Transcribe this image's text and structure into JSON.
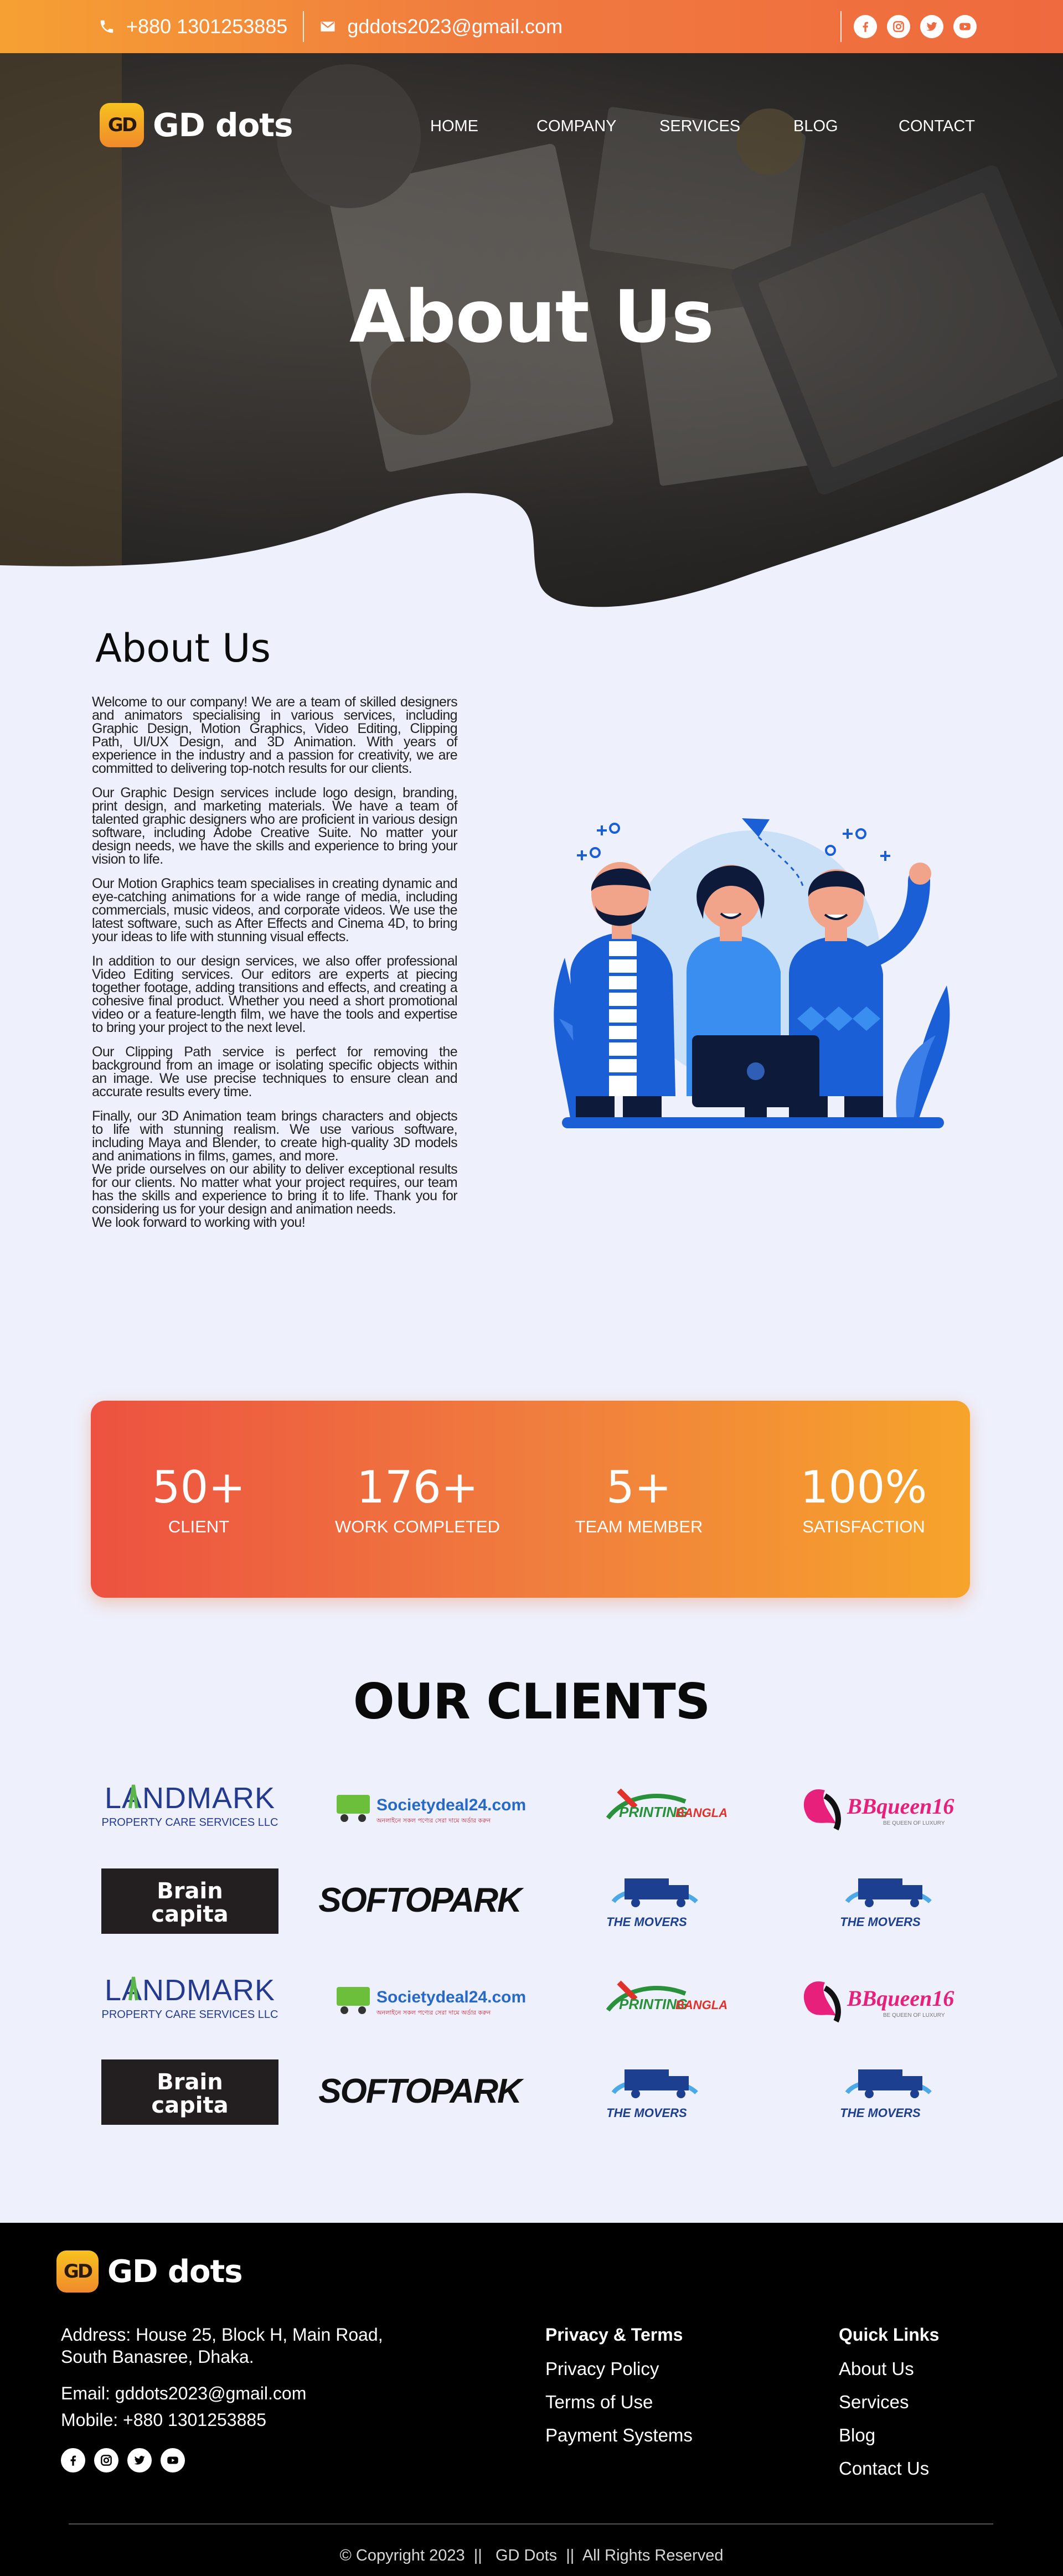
{
  "topbar": {
    "phone": "+880 1301253885",
    "email": "gddots2023@gmail.com",
    "social_icons": [
      "facebook-icon",
      "instagram-icon",
      "twitter-icon",
      "youtube-icon"
    ]
  },
  "brand": {
    "mark": "GD",
    "name": "GD dots"
  },
  "nav": {
    "items": [
      "HOME",
      "COMPANY",
      "SERVICES",
      "BLOG",
      "CONTACT"
    ]
  },
  "hero": {
    "title": "About Us"
  },
  "about": {
    "heading": "About Us",
    "paragraphs": [
      "Welcome to our company! We are a team of skilled designers and animators specialising in various services, including Graphic Design, Motion Graphics, Video Editing, Clipping Path, UI/UX Design, and 3D Animation. With years of experience in the industry and a passion for creativity, we are committed to delivering top-notch results for our clients.",
      "Our Graphic Design services include logo design, branding, print design, and marketing materials. We have a team of talented graphic designers who are proficient in various design software, including Adobe Creative Suite. No matter your design needs, we have the skills and experience to bring your vision to life.",
      "Our Motion Graphics team specialises in creating dynamic and eye-catching animations for a wide range of media, including commercials, music videos, and corporate videos. We use the latest software, such as After Effects and Cinema 4D, to bring your ideas to life with stunning visual effects.",
      "In addition to our design services, we also offer professional Video Editing services. Our editors are experts at piecing together footage, adding transitions and effects, and creating a cohesive final product. Whether you need a short promotional video or a feature-length film, we have the tools and expertise to bring your project to the next level.",
      "Our Clipping Path service is perfect for removing the background from an image or isolating specific objects within an image. We use precise techniques to ensure clean and accurate results every time.",
      "Finally, our 3D Animation team brings characters and objects to life with stunning realism. We use various software, including Maya and Blender, to create high-quality 3D models and animations in films, games, and more.",
      "We pride ourselves on our ability to deliver exceptional results for our clients. No matter what your project requires, our team has the skills and experience to bring it to life. Thank you for considering us for your design and animation needs.",
      "We look forward to working with you!"
    ]
  },
  "stats": [
    {
      "value": "50+",
      "label": "CLIENT"
    },
    {
      "value": "176+",
      "label": "WORK COMPLETED"
    },
    {
      "value": "5+",
      "label": "TEAM MEMBER"
    },
    {
      "value": "100%",
      "label": "SATISFACTION"
    }
  ],
  "clients": {
    "heading": "OUR CLIENTS",
    "logos": {
      "landmark": {
        "title": "LANDMARK",
        "sub": "PROPERTY CARE SERVICES LLC"
      },
      "societydeal": {
        "title": "Societydeal24.com",
        "sub": "অনলাইনে সকল পণ্যের সেরা দামে অর্ডার করুন"
      },
      "printing": {
        "title": "PRINTING",
        "accent": "BANGLA"
      },
      "bbqueen": {
        "title": "BBqueen16",
        "sub": "BE QUEEN OF LUXURY"
      },
      "brain": {
        "line1": "Brain",
        "line2": "capita"
      },
      "softopark": {
        "title": "SOFTOPARK"
      },
      "movers": {
        "title": "THE MOVERS"
      }
    }
  },
  "footer": {
    "address_line1": "Address: House 25, Block H, Main Road,",
    "address_line2": "South Banasree, Dhaka.",
    "email": "Email: gddots2023@gmail.com",
    "mobile": "Mobile: +880 1301253885",
    "col1": {
      "title": "Privacy & Terms",
      "links": [
        "Privacy Policy",
        "Terms of Use",
        "Payment Systems"
      ]
    },
    "col2": {
      "title": "Quick Links",
      "links": [
        "About Us",
        "Services",
        "Blog",
        "Contact Us"
      ]
    },
    "copyright": "© Copyright 2023  ||   GD Dots  ||  All Rights Reserved"
  },
  "colors": {
    "accent_orange": "#f07b3f",
    "accent_yellow": "#f6a42b",
    "page_bg": "#eef0fc",
    "footer_bg": "#000000",
    "illustration_blue": "#1a5fd6"
  }
}
